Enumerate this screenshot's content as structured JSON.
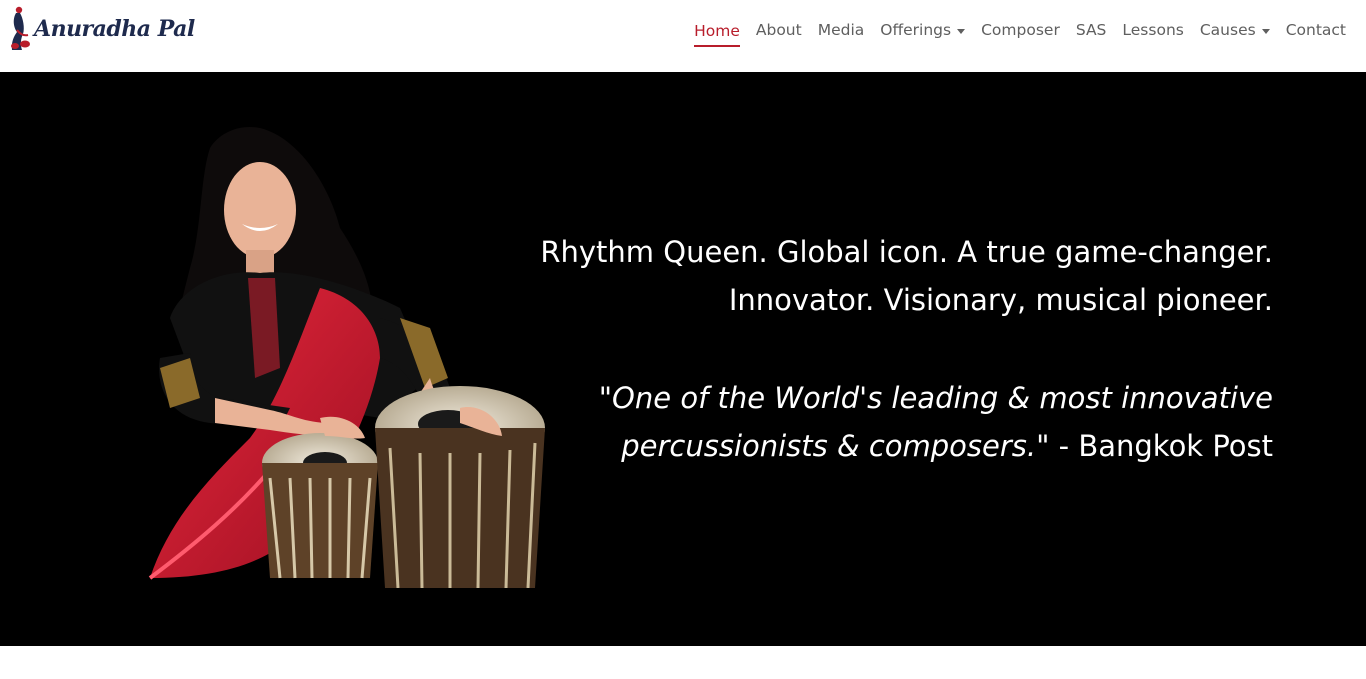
{
  "brand": {
    "logo_text": "Anuradha Pal"
  },
  "nav": {
    "items": [
      {
        "label": "Home",
        "active": true,
        "dropdown": false
      },
      {
        "label": "About",
        "active": false,
        "dropdown": false
      },
      {
        "label": "Media",
        "active": false,
        "dropdown": false
      },
      {
        "label": "Offerings",
        "active": false,
        "dropdown": true
      },
      {
        "label": "Composer",
        "active": false,
        "dropdown": false
      },
      {
        "label": "SAS",
        "active": false,
        "dropdown": false
      },
      {
        "label": "Lessons",
        "active": false,
        "dropdown": false
      },
      {
        "label": "Causes",
        "active": false,
        "dropdown": true
      },
      {
        "label": "Contact",
        "active": false,
        "dropdown": false
      }
    ]
  },
  "hero": {
    "tagline_line1": "Rhythm Queen. Global icon. A true game-changer.",
    "tagline_line2": "Innovator. Visionary, musical pioneer.",
    "quote_line1": "\"One of the World's leading & most innovative",
    "quote_line2": "percussionists & composers.\"",
    "quote_source": " - Bangkok Post"
  },
  "colors": {
    "accent": "#b81d2b",
    "nav_text": "#5f5f5f",
    "logo": "#1e2a4d",
    "hero_bg": "#000000"
  }
}
